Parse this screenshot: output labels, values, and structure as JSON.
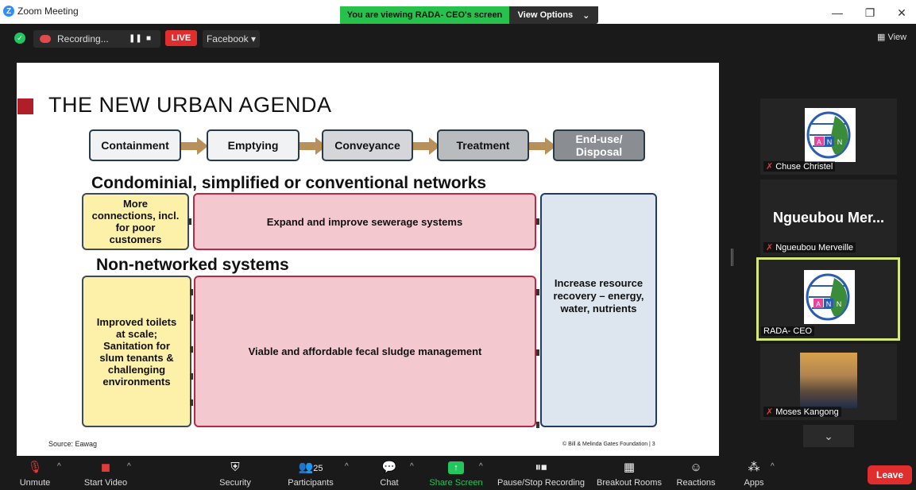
{
  "window": {
    "title": "Zoom Meeting",
    "viewing_banner": "You are viewing RADA- CEO's screen",
    "view_options": "View Options",
    "controls": {
      "minimize": "—",
      "restore": "❐",
      "close": "✕"
    }
  },
  "meeting_bar": {
    "recording": "Recording...",
    "live": "LIVE",
    "stream_target": "Facebook ▾",
    "view_label": "View"
  },
  "slide": {
    "title": "THE NEW URBAN AGENDA",
    "stages": [
      "Containment",
      "Emptying",
      "Conveyance",
      "Treatment",
      "End-use/ Disposal"
    ],
    "section1": "Condominial, simplified or conventional networks",
    "section1_left": "More connections, incl. for poor customers",
    "section1_center": "Expand and improve sewerage systems",
    "section2": "Non-networked systems",
    "section2_left": "Improved toilets at scale; Sanitation for slum tenants & challenging environments",
    "section2_center": "Viable and affordable fecal sludge management",
    "right_box": "Increase resource recovery – energy, water, nutrients",
    "source": "Source: Eawag",
    "footer": "© Bill & Melinda Gates Foundation  |  3"
  },
  "participants": [
    {
      "name": "Chuse Christel",
      "muted": true,
      "display": "logo"
    },
    {
      "name": "Ngueubou Merveille",
      "muted": true,
      "display": "text",
      "big_name": "Ngueubou Mer..."
    },
    {
      "name": "RADA- CEO",
      "muted": false,
      "display": "logo",
      "active": true
    },
    {
      "name": "Moses Kangong",
      "muted": true,
      "display": "photo"
    }
  ],
  "toolbar": {
    "unmute": "Unmute",
    "start_video": "Start Video",
    "security": "Security",
    "participants": "Participants",
    "participants_count": "25",
    "chat": "Chat",
    "share_screen": "Share Screen",
    "pause_recording": "Pause/Stop Recording",
    "breakout_rooms": "Breakout Rooms",
    "reactions": "Reactions",
    "apps": "Apps",
    "leave": "Leave"
  },
  "colors": {
    "accent_green": "#27c24c",
    "leave_red": "#e02d2d",
    "active_outline": "#d5e87a",
    "slide_red": "#b01e2a"
  }
}
